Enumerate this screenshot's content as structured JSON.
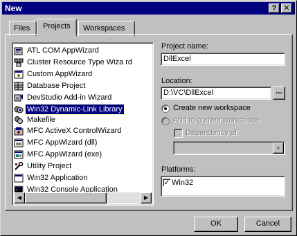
{
  "window": {
    "title": "New",
    "help_glyph": "?",
    "close_glyph": "✕"
  },
  "tabs": [
    {
      "label": "Files",
      "active": false
    },
    {
      "label": "Projects",
      "active": true
    },
    {
      "label": "Workspaces",
      "active": false
    }
  ],
  "project_types": [
    {
      "label": "ATL COM AppWizard",
      "icon": "atl-wizard-icon",
      "selected": false
    },
    {
      "label": "Cluster Resource Type Wiza rd",
      "icon": "cluster-wizard-icon",
      "selected": false
    },
    {
      "label": "Custom AppWizard",
      "icon": "custom-wizard-icon",
      "selected": false
    },
    {
      "label": "Database Project",
      "icon": "database-icon",
      "selected": false
    },
    {
      "label": "DevStudio Add-in Wizard",
      "icon": "addin-wizard-icon",
      "selected": false
    },
    {
      "label": "Win32 Dynamic-Link Library",
      "icon": "dll-icon",
      "selected": true
    },
    {
      "label": "Makefile",
      "icon": "makefile-icon",
      "selected": false
    },
    {
      "label": "MFC ActiveX ControlWizard",
      "icon": "activex-icon",
      "selected": false
    },
    {
      "label": "MFC AppWizard (dll)",
      "icon": "mfc-dll-icon",
      "selected": false
    },
    {
      "label": "MFC AppWizard (exe)",
      "icon": "mfc-exe-icon",
      "selected": false
    },
    {
      "label": "Utility Project",
      "icon": "utility-icon",
      "selected": false
    },
    {
      "label": "Win32 Application",
      "icon": "win32-app-icon",
      "selected": false
    },
    {
      "label": "Win32 Console Application",
      "icon": "console-app-icon",
      "selected": false
    }
  ],
  "scrollbar": {
    "left_glyph": "◀",
    "right_glyph": "▶"
  },
  "form": {
    "project_name_label": "Project name:",
    "project_name_value": "DllExcel",
    "location_label": "Location:",
    "location_value": "D:\\VC\\DllExcel",
    "browse_label": "...",
    "create_workspace_label": "Create new workspace",
    "add_workspace_label": "Add to current workspace",
    "dependency_label": "Dependency of:",
    "platforms_label": "Platforms:",
    "platforms": [
      {
        "label": "Win32",
        "checked": true
      }
    ],
    "check_glyph": "✓",
    "dropdown_glyph": "▼"
  },
  "buttons": {
    "ok": "OK",
    "cancel": "Cancel"
  }
}
